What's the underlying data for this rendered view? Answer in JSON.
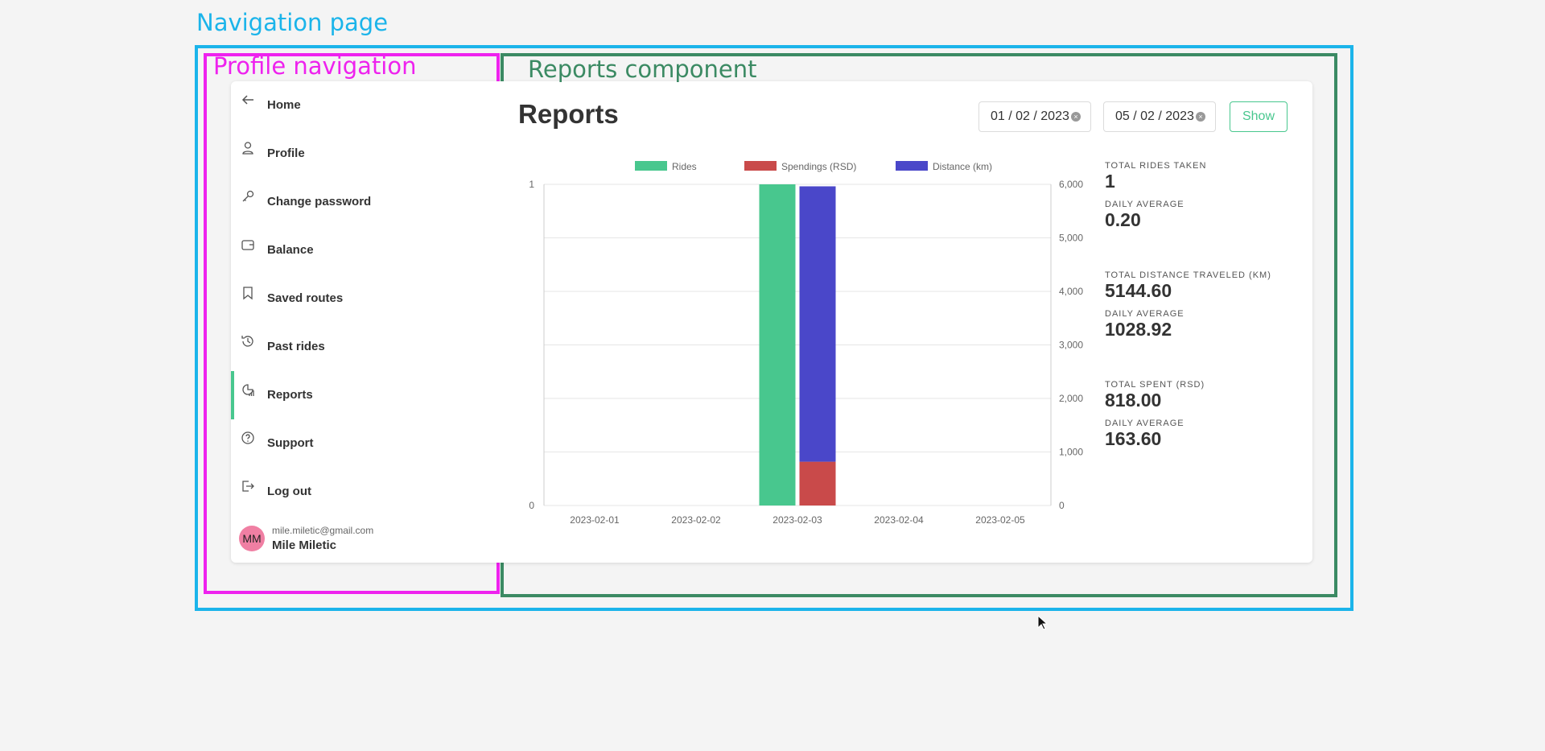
{
  "annotations": {
    "navigation_page": "Navigation page",
    "profile_navigation": "Profile navigation",
    "reports_component": "Reports component"
  },
  "sidebar": {
    "items": [
      {
        "label": "Home",
        "icon": "arrow-left-icon"
      },
      {
        "label": "Profile",
        "icon": "user-icon"
      },
      {
        "label": "Change password",
        "icon": "key-icon"
      },
      {
        "label": "Balance",
        "icon": "wallet-icon"
      },
      {
        "label": "Saved routes",
        "icon": "bookmark-icon"
      },
      {
        "label": "Past rides",
        "icon": "history-icon"
      },
      {
        "label": "Reports",
        "icon": "report-chart-icon",
        "active": true
      },
      {
        "label": "Support",
        "icon": "question-circle-icon"
      },
      {
        "label": "Log out",
        "icon": "logout-icon"
      }
    ],
    "user": {
      "initials": "MM",
      "email": "mile.miletic@gmail.com",
      "name": "Mile Miletic"
    }
  },
  "reports": {
    "title": "Reports",
    "from_date": "01 / 02 / 2023",
    "to_date": "05 / 02 / 2023",
    "show_label": "Show",
    "stats": {
      "rides_label": "TOTAL RIDES TAKEN",
      "rides_total": "1",
      "rides_avg_label": "DAILY AVERAGE",
      "rides_avg": "0.20",
      "distance_label": "TOTAL DISTANCE TRAVELED (KM)",
      "distance_total": "5144.60",
      "distance_avg_label": "DAILY AVERAGE",
      "distance_avg": "1028.92",
      "spent_label": "TOTAL SPENT (RSD)",
      "spent_total": "818.00",
      "spent_avg_label": "DAILY AVERAGE",
      "spent_avg": "163.60"
    }
  },
  "colors": {
    "accent": "#48c78e",
    "rides": "#48c78e",
    "spendings": "#c94a4a",
    "distance": "#4a47c9"
  },
  "chart_data": {
    "type": "bar",
    "categories": [
      "2023-02-01",
      "2023-02-02",
      "2023-02-03",
      "2023-02-04",
      "2023-02-05"
    ],
    "series": [
      {
        "name": "Rides",
        "axis": "left",
        "stack": "rides",
        "values": [
          0,
          0,
          1,
          0,
          0
        ],
        "color": "#48c78e"
      },
      {
        "name": "Spendings (RSD)",
        "axis": "right",
        "stack": "money",
        "values": [
          0,
          0,
          818,
          0,
          0
        ],
        "color": "#c94a4a"
      },
      {
        "name": "Distance (km)",
        "axis": "right",
        "stack": "money",
        "values": [
          0,
          0,
          5144.6,
          0,
          0
        ],
        "color": "#4a47c9"
      }
    ],
    "y_left": {
      "range": [
        0,
        1
      ],
      "ticks": [
        "0",
        "1"
      ]
    },
    "y_right": {
      "range": [
        0,
        6000
      ],
      "ticks": [
        "0",
        "1,000",
        "2,000",
        "3,000",
        "4,000",
        "5,000",
        "6,000"
      ]
    },
    "legend": "top",
    "grid": true
  }
}
